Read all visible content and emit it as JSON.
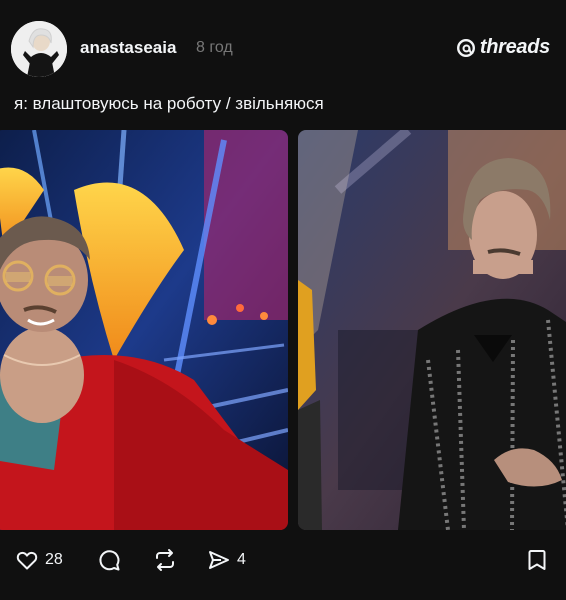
{
  "post": {
    "username": "anastaseaia",
    "time": "8 год",
    "caption": "я: влаштовуюсь на роботу / звільняюся"
  },
  "brand": {
    "name": "threads"
  },
  "actions": {
    "likes": "28",
    "shares": "4"
  },
  "icons": {
    "like": "heart-icon",
    "comment": "comment-bubble-icon",
    "repost": "repost-icon",
    "share": "send-icon",
    "save": "bookmark-icon"
  },
  "colors": {
    "background": "#101010",
    "text": "#f3f5f7",
    "muted": "#777777"
  }
}
